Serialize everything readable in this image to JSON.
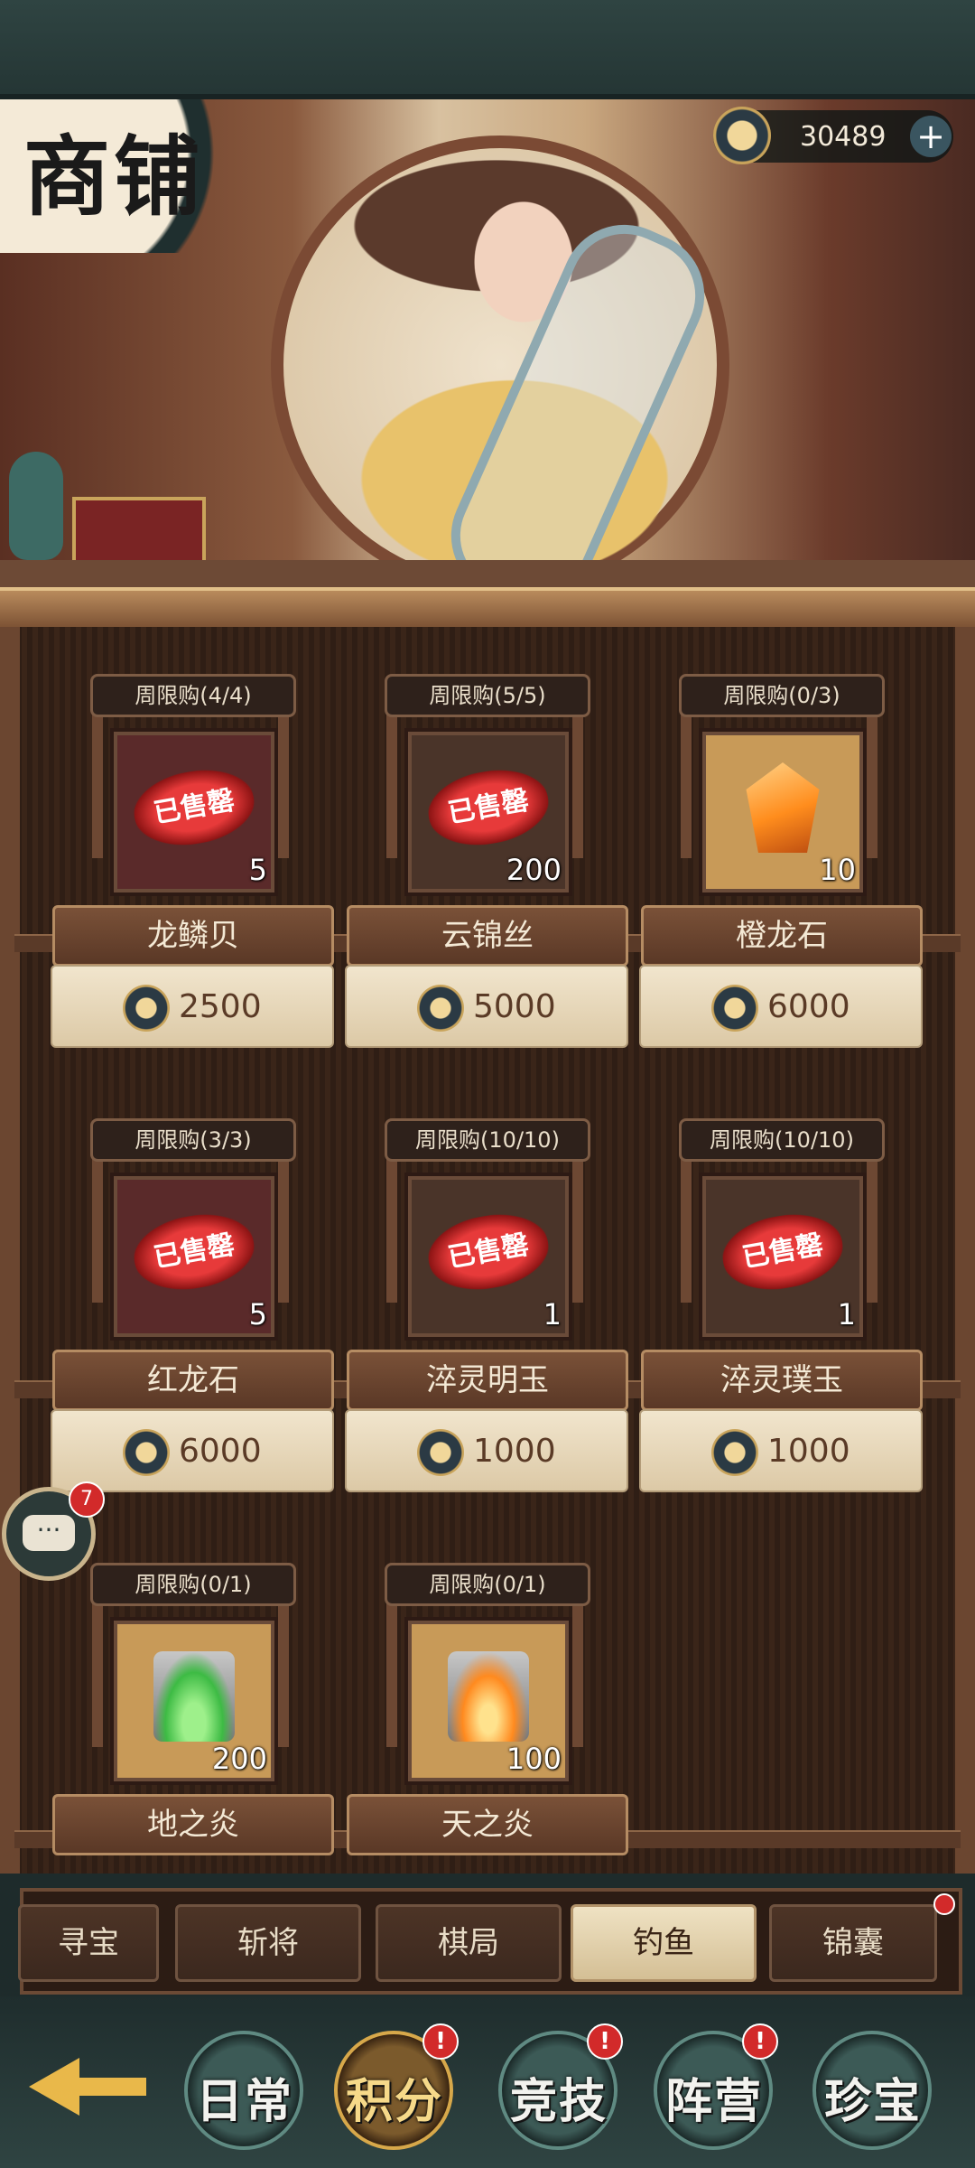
{
  "header": {
    "title": "商铺",
    "currency": {
      "icon": "moon-coin-icon",
      "value": "30489",
      "add_label": "+"
    }
  },
  "items": [
    {
      "limit": "周限购(4/4)",
      "name": "龙鳞贝",
      "count": "5",
      "price": "2500",
      "sold_out": true,
      "sold_label": "已售罄"
    },
    {
      "limit": "周限购(5/5)",
      "name": "云锦丝",
      "count": "200",
      "price": "5000",
      "sold_out": true,
      "sold_label": "已售罄"
    },
    {
      "limit": "周限购(0/3)",
      "name": "橙龙石",
      "count": "10",
      "price": "6000",
      "sold_out": false
    },
    {
      "limit": "周限购(3/3)",
      "name": "红龙石",
      "count": "5",
      "price": "6000",
      "sold_out": true,
      "sold_label": "已售罄"
    },
    {
      "limit": "周限购(10/10)",
      "name": "淬灵明玉",
      "count": "1",
      "price": "1000",
      "sold_out": true,
      "sold_label": "已售罄"
    },
    {
      "limit": "周限购(10/10)",
      "name": "淬灵璞玉",
      "count": "1",
      "price": "1000",
      "sold_out": true,
      "sold_label": "已售罄"
    },
    {
      "limit": "周限购(0/1)",
      "name": "地之炎",
      "count": "200",
      "sold_out": false
    },
    {
      "limit": "周限购(0/1)",
      "name": "天之炎",
      "count": "100",
      "sold_out": false
    }
  ],
  "chat": {
    "badge": "7",
    "icon": "chat-bubble-icon",
    "glyph": "···"
  },
  "tabs": [
    {
      "label": "寻宝",
      "active": false
    },
    {
      "label": "斩将",
      "active": false
    },
    {
      "label": "棋局",
      "active": false
    },
    {
      "label": "钓鱼",
      "active": true
    },
    {
      "label": "锦囊",
      "active": false,
      "alert": true
    }
  ],
  "bottom_nav": [
    {
      "label": "日常",
      "active": false,
      "alert": false
    },
    {
      "label": "积分",
      "active": true,
      "alert": true
    },
    {
      "label": "竞技",
      "active": false,
      "alert": true
    },
    {
      "label": "阵营",
      "active": false,
      "alert": true
    },
    {
      "label": "珍宝",
      "active": false,
      "alert": false
    }
  ],
  "alert_glyph": "!",
  "colors": {
    "accent_gold": "#e9b84a",
    "sold_red": "#d22a2a",
    "wood_dark": "#3a2519"
  }
}
